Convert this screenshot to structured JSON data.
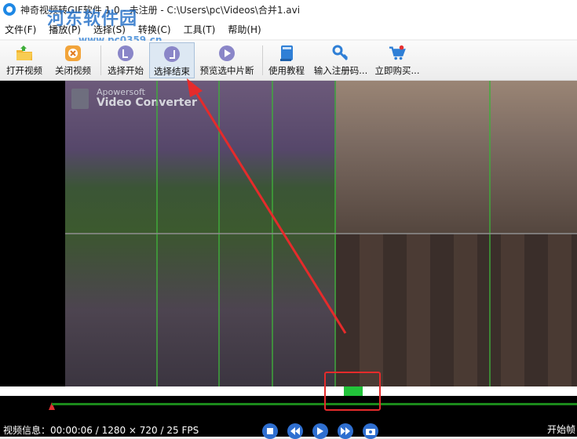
{
  "window": {
    "title": "神奇视频转GIF软件 1.0 - 未注册 - C:\\Users\\pc\\Videos\\合并1.avi"
  },
  "menu": [
    "文件(F)",
    "播放(P)",
    "选择(S)",
    "转换(C)",
    "工具(T)",
    "帮助(H)"
  ],
  "watermark": {
    "logo": "河东软件园",
    "url": "www.pc0359.cn"
  },
  "toolbar": {
    "open_video": {
      "label": "打开视频",
      "icon": "folder-open-icon"
    },
    "close_video": {
      "label": "关闭视频",
      "icon": "close-video-icon"
    },
    "select_start": {
      "label": "选择开始",
      "icon": "select-start-icon"
    },
    "select_end": {
      "label": "选择结束",
      "icon": "select-end-icon",
      "active": true
    },
    "preview_clip": {
      "label": "预览选中片断",
      "icon": "preview-play-icon"
    },
    "tutorial": {
      "label": "使用教程",
      "icon": "book-icon"
    },
    "register": {
      "label": "输入注册码...",
      "icon": "key-icon"
    },
    "buy": {
      "label": "立即购买...",
      "icon": "cart-icon"
    }
  },
  "video": {
    "overlay_brand": "Apowersoft",
    "overlay_product": "Video Converter"
  },
  "status": {
    "info": "视频信息：00:00:06 / 1280 × 720 / 25 FPS",
    "right_label": "开始帧"
  },
  "colors": {
    "accent": "#2f6fd0",
    "seek_thumb": "#22c33a",
    "timeline": "#1b8a1b",
    "annotation": "#e52b2b"
  }
}
